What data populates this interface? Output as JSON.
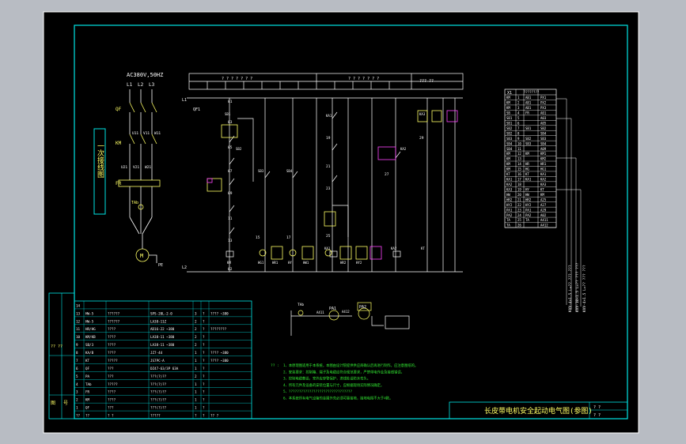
{
  "colors": {
    "background": "#000000",
    "frame": "#ffffff",
    "border": "#00e5e5",
    "wire": "#ffffff",
    "label": "#ffff66",
    "accent": "#ff44ff",
    "note": "#33ee33",
    "table": "#00e5e5"
  },
  "motor_circuit": {
    "supply": "AC380V,50HZ",
    "phases": [
      "L1",
      "L2",
      "L3"
    ],
    "labels": {
      "qf": "QF",
      "km": "KM",
      "fr": "FR",
      "m": "M",
      "pe": "PE",
      "u1": "U11",
      "v1": "V11",
      "w1": "W11",
      "u2": "U21",
      "v2": "V21",
      "w2": "W21",
      "ta": "TAb"
    },
    "vertical_title": "一次接线图"
  },
  "control_circuit": {
    "header_left": "? ? ? ? ? ? ?",
    "header_mid": "? ? ? ? ? ? ?",
    "header_right": "??? ??",
    "left_labels": [
      "L1",
      "QF1",
      "L2"
    ],
    "node_labels": [
      "01",
      "03",
      "05",
      "07",
      "09",
      "11",
      "13",
      "15",
      "17",
      "19",
      "21",
      "23",
      "25",
      "27",
      "29",
      "02"
    ],
    "relays": [
      "SB1",
      "SB2",
      "SB3",
      "SB4",
      "KA1",
      "KA2",
      "KA3"
    ],
    "coils": [
      "KM",
      "KA1",
      "KA2",
      "KT"
    ],
    "lamps": [
      "HG1",
      "HR1",
      "HY",
      "HW1",
      "HR2",
      "HY2"
    ]
  },
  "meter_circuit": {
    "ta_label": "TAb",
    "pa1": "PA1",
    "pa2": "PA2",
    "wires": [
      "A411",
      "A412"
    ]
  },
  "terminal_table": {
    "header": "X1",
    "code": "????????",
    "rows": [
      [
        "KM",
        "1",
        "AB1",
        "PX1"
      ],
      [
        "KM",
        "2",
        "AB1",
        "PX2"
      ],
      [
        "KM",
        "3",
        "AB1",
        "PX3"
      ],
      [
        "SB",
        "4",
        "FR",
        "A01"
      ],
      [
        "SB1",
        "5",
        "",
        "A03"
      ],
      [
        "SB1",
        "6",
        "",
        "A05"
      ],
      [
        "SB2",
        "7",
        "SB1",
        "SB2"
      ],
      [
        "SB2",
        "8",
        "",
        "SB4"
      ],
      [
        "SB3",
        "9",
        "SB2",
        "SB3"
      ],
      [
        "SB4",
        "10",
        "SB3",
        "SB4"
      ],
      [
        "SB4",
        "11",
        "",
        "A09"
      ],
      [
        "KM",
        "12",
        "KM",
        "KM1"
      ],
      [
        "KM",
        "13",
        "",
        "KM2"
      ],
      [
        "KM",
        "14",
        "HR",
        "HR1"
      ],
      [
        "KM",
        "15",
        "HG",
        "HG1"
      ],
      [
        "KT",
        "16",
        "KT",
        "KA1"
      ],
      [
        "KA1",
        "17",
        "KA1",
        "KA2"
      ],
      [
        "KA2",
        "18",
        "",
        "KA3"
      ],
      [
        "KA3",
        "19",
        "HY",
        "KT"
      ],
      [
        "HW",
        "20",
        "HW",
        "KM"
      ],
      [
        "HR2",
        "21",
        "HR2",
        "A25"
      ],
      [
        "HY2",
        "22",
        "HY2",
        "A27"
      ],
      [
        "PA1",
        "23",
        "PA1",
        "A29"
      ],
      [
        "PA2",
        "24",
        "PA2",
        "A02"
      ],
      [
        "TA",
        "25",
        "TA",
        "A411"
      ],
      [
        "TA",
        "26",
        "",
        "A412"
      ]
    ],
    "cable_labels": [
      "KVV-4×1.5 L=?? ??? ???",
      "KVV-10×1.5 L=?? ??? ???",
      "KVV-4×1.5 L=?? ??? ???"
    ]
  },
  "bom": {
    "stamp": "?? ??",
    "side_labels": [
      "图",
      "号"
    ],
    "rows": [
      [
        "14",
        "",
        "",
        "",
        "",
        "",
        ""
      ],
      [
        "13",
        "HW-5",
        "??????",
        "SPS-20L-2-0",
        "3",
        "?",
        "???? ~380"
      ],
      [
        "12",
        "HW-5",
        "??????",
        "LA38-11Z",
        "2",
        "?",
        ""
      ],
      [
        "11",
        "HR/HG",
        "????",
        "AD16-22 ~380",
        "2",
        "?",
        "????????"
      ],
      [
        "10",
        "KM/KB",
        "????",
        "LA38-11 ~380",
        "2",
        "?",
        ""
      ],
      [
        "9",
        "SB/3",
        "????",
        "LA38-11 ~380",
        "2",
        "?",
        ""
      ],
      [
        "8",
        "KA/B",
        "????",
        "JZ7-44",
        "1",
        "?",
        "???? ~380"
      ],
      [
        "7",
        "KT",
        "?????",
        "JS7PC-A",
        "1",
        "?",
        "???? ~380"
      ],
      [
        "6",
        "QF",
        "???",
        "DZ47-63/3P 63A",
        "1",
        "?",
        ""
      ],
      [
        "5",
        "PA",
        "???",
        "???(?)??",
        "2",
        "?",
        ""
      ],
      [
        "4",
        "TAb",
        "?????",
        "???(?)??",
        "1",
        "?",
        ""
      ],
      [
        "3",
        "FR",
        "????",
        "???(?)??",
        "1",
        "?",
        ""
      ],
      [
        "2",
        "KM",
        "????",
        "???(?)??",
        "1",
        "?",
        ""
      ],
      [
        "1",
        "QF",
        "???",
        "???(?)??",
        "1",
        "?",
        ""
      ],
      [
        "??",
        "??",
        "? ?",
        "?????",
        "?",
        "?",
        "?? ?"
      ]
    ]
  },
  "notes": {
    "prefix": "?? :",
    "lines": [
      "1、本原理图适用于本系统，本图由设计院提供供应商确认后再进行制作，应注意图纸的。",
      "2、安装要求：控制箱、端子及电缆应符合规范要求，严禁带电作业及接线错误。",
      "3、控制电缆敷设，室外应穿管保护，进线处设防水弯头。",
      "4、所有元件及设备的安装位置与尺寸，应根据现场实际情况确定。",
      "5、???????????????????????????????",
      "6、本系统所有电气设备的金属外壳必须可靠接地，接地电阻不大于4欧。"
    ]
  },
  "title_block": {
    "title": "长皮带电机安全起动电气图(参图)",
    "right_top": "? ?",
    "right_bottom": "? ?"
  }
}
